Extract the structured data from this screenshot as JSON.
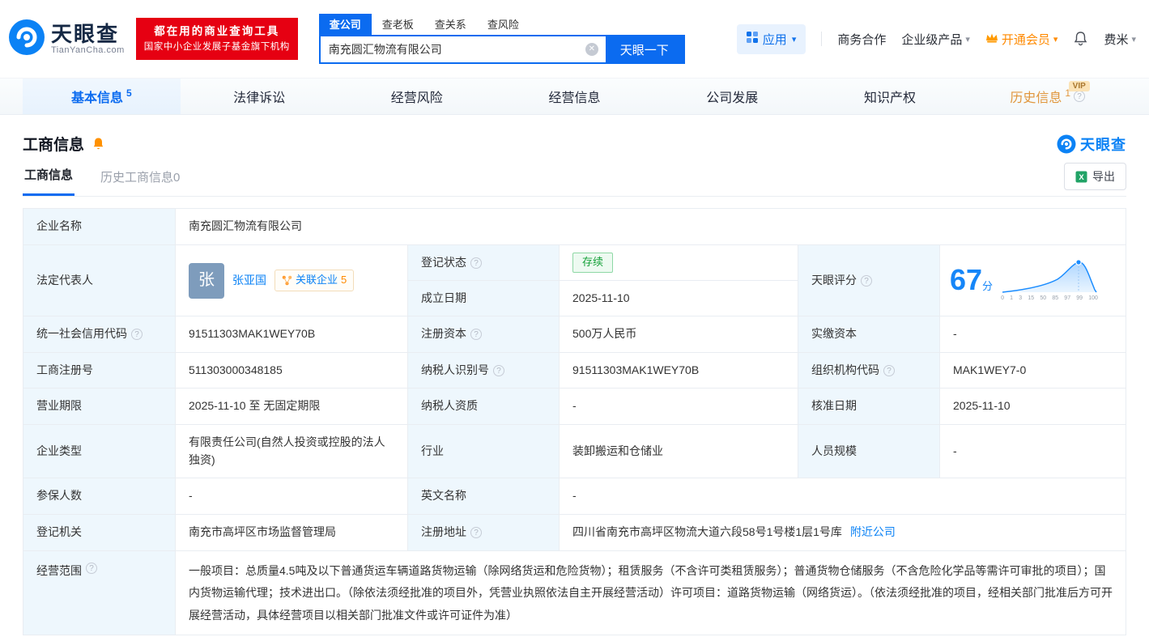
{
  "colors": {
    "brand_blue": "#0b6bf0",
    "banner_red": "#e60012",
    "member_orange": "#ff8a00",
    "status_green": "#16a13a"
  },
  "header": {
    "logo": {
      "brand": "天眼查",
      "domain": "TianYanCha.com"
    },
    "banner": {
      "line1": "都在用的商业查询工具",
      "line2": "国家中小企业发展子基金旗下机构"
    },
    "search": {
      "tabs": [
        {
          "label": "查公司"
        },
        {
          "label": "查老板"
        },
        {
          "label": "查关系"
        },
        {
          "label": "查风险"
        }
      ],
      "value": "南充圆汇物流有限公司",
      "button": "天眼一下"
    },
    "nav": {
      "apps": "应用",
      "cooperation": "商务合作",
      "enterprise": "企业级产品",
      "member": "开通会员",
      "user": "费米"
    }
  },
  "tabs": [
    {
      "label": "基本信息",
      "count": "5"
    },
    {
      "label": "法律诉讼"
    },
    {
      "label": "经营风险"
    },
    {
      "label": "经营信息"
    },
    {
      "label": "公司发展"
    },
    {
      "label": "知识产权"
    },
    {
      "label": "历史信息",
      "count": "1",
      "vip": "VIP"
    }
  ],
  "section": {
    "title": "工商信息",
    "logo": "天眼查"
  },
  "subtabs": {
    "current": "工商信息",
    "history": "历史工商信息0"
  },
  "export_label": "导出",
  "table": {
    "company_name_label": "企业名称",
    "company_name": "南充圆汇物流有限公司",
    "legal_rep_label": "法定代表人",
    "legal_rep": {
      "avatar": "张",
      "name": "张亚国",
      "related_label": "关联企业",
      "related_count": "5"
    },
    "reg_status_label": "登记状态",
    "reg_status": "存续",
    "est_date_label": "成立日期",
    "est_date": "2025-11-10",
    "score_label": "天眼评分",
    "score_value": "67",
    "score_unit": "分",
    "score_axis": [
      "0",
      "1",
      "3",
      "15",
      "50",
      "85",
      "97",
      "99",
      "100"
    ],
    "credit_code_label": "统一社会信用代码",
    "credit_code": "91511303MAK1WEY70B",
    "reg_capital_label": "注册资本",
    "reg_capital": "500万人民币",
    "paid_capital_label": "实缴资本",
    "paid_capital": "-",
    "reg_number_label": "工商注册号",
    "reg_number": "511303000348185",
    "taxpayer_id_label": "纳税人识别号",
    "taxpayer_id": "91511303MAK1WEY70B",
    "org_code_label": "组织机构代码",
    "org_code": "MAK1WEY7-0",
    "business_term_label": "营业期限",
    "business_term": "2025-11-10 至 无固定期限",
    "taxpayer_quality_label": "纳税人资质",
    "taxpayer_quality": "-",
    "approval_date_label": "核准日期",
    "approval_date": "2025-11-10",
    "company_type_label": "企业类型",
    "company_type": "有限责任公司(自然人投资或控股的法人独资)",
    "industry_label": "行业",
    "industry": "装卸搬运和仓储业",
    "staff_size_label": "人员规模",
    "staff_size": "-",
    "insured_label": "参保人数",
    "insured": "-",
    "english_name_label": "英文名称",
    "english_name": "-",
    "registry_label": "登记机关",
    "registry": "南充市高坪区市场监督管理局",
    "address_label": "注册地址",
    "address": "四川省南充市高坪区物流大道六段58号1号楼1层1号库",
    "nearby_link": "附近公司",
    "scope_label": "经营范围",
    "scope": "一般项目：总质量4.5吨及以下普通货运车辆道路货物运输（除网络货运和危险货物）；租赁服务（不含许可类租赁服务）；普通货物仓储服务（不含危险化学品等需许可审批的项目）；国内货物运输代理；技术进出口。（除依法须经批准的项目外，凭营业执照依法自主开展经营活动）许可项目：道路货物运输（网络货运）。（依法须经批准的项目，经相关部门批准后方可开展经营活动，具体经营项目以相关部门批准文件或许可证件为准）"
  }
}
